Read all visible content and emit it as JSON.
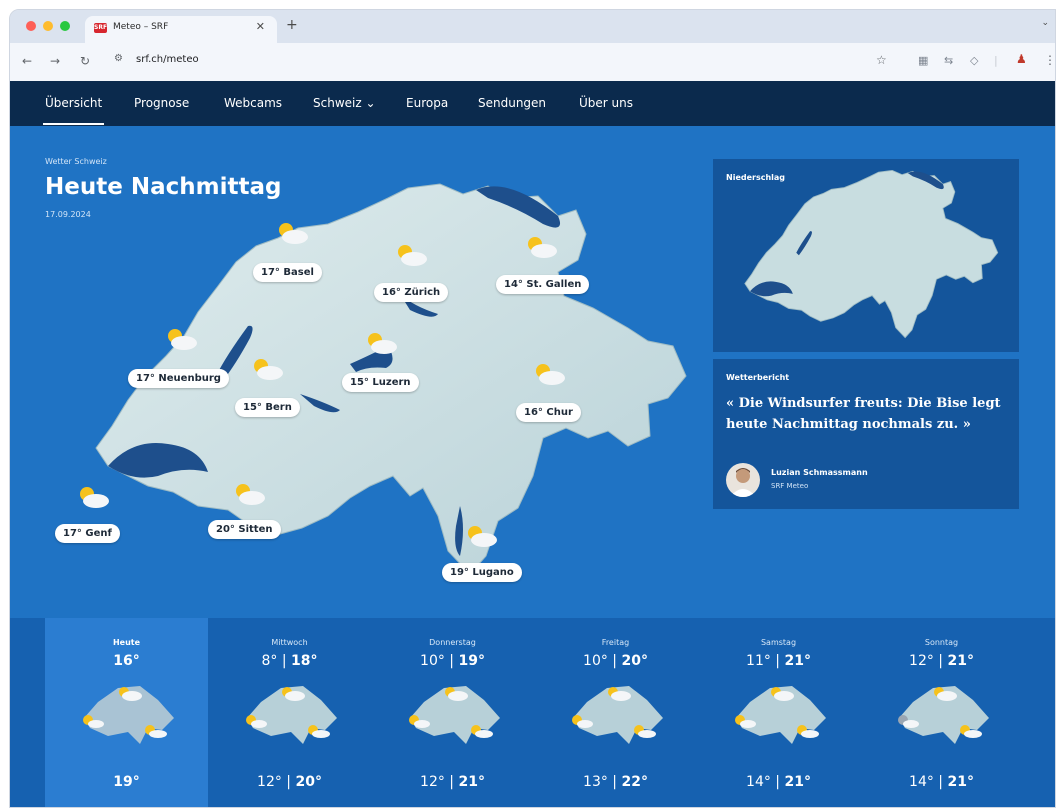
{
  "browser": {
    "tab_title": "Meteo – SRF",
    "tab_favicon": "SRF",
    "url": "srf.ch/meteo"
  },
  "nav": {
    "items": [
      "Übersicht",
      "Prognose",
      "Webcams",
      "Schweiz ⌄",
      "Europa",
      "Sendungen",
      "Über uns"
    ]
  },
  "main": {
    "kicker": "Wetter Schweiz",
    "title": "Heute Nachmittag",
    "date": "17.09.2024"
  },
  "cities": [
    {
      "label": "17°  Basel",
      "icon": "partly-cloudy-icon"
    },
    {
      "label": "16°  Zürich",
      "icon": "partly-cloudy-icon"
    },
    {
      "label": "14°  St. Gallen",
      "icon": "partly-cloudy-icon"
    },
    {
      "label": "17°  Neuenburg",
      "icon": "partly-cloudy-icon"
    },
    {
      "label": "15°  Luzern",
      "icon": "partly-cloudy-icon"
    },
    {
      "label": "15°  Bern",
      "icon": "partly-cloudy-icon"
    },
    {
      "label": "16°  Chur",
      "icon": "partly-cloudy-icon"
    },
    {
      "label": "17°  Genf",
      "icon": "partly-cloudy-icon"
    },
    {
      "label": "20°  Sitten",
      "icon": "partly-cloudy-icon"
    },
    {
      "label": "19°  Lugano",
      "icon": "partly-cloudy-icon"
    }
  ],
  "precip_panel": {
    "label": "Niederschlag"
  },
  "report": {
    "label": "Wetterbericht",
    "quote": "« Die Windsurfer freuts: Die Bise legt heute Nachmittag nochmals zu. »",
    "author": "Luzian Schmassmann",
    "author_sub": "SRF Meteo"
  },
  "forecast": [
    {
      "name": "Heute",
      "top": "16°",
      "top_min": "",
      "top_max": "",
      "bottom": "19°",
      "bottom_min": "",
      "bottom_max": ""
    },
    {
      "name": "Mittwoch",
      "top_min": "8°",
      "top_max": "18°",
      "bottom_min": "12°",
      "bottom_max": "20°"
    },
    {
      "name": "Donnerstag",
      "top_min": "10°",
      "top_max": "19°",
      "bottom_min": "12°",
      "bottom_max": "21°"
    },
    {
      "name": "Freitag",
      "top_min": "10°",
      "top_max": "20°",
      "bottom_min": "13°",
      "bottom_max": "22°"
    },
    {
      "name": "Samstag",
      "top_min": "11°",
      "top_max": "21°",
      "bottom_min": "14°",
      "bottom_max": "21°"
    },
    {
      "name": "Sonntag",
      "top_min": "12°",
      "top_max": "21°",
      "bottom_min": "14°",
      "bottom_max": "21°"
    }
  ],
  "colors": {
    "nav_bg": "#0b2a4d",
    "main_bg": "#1f73c4",
    "panel_bg": "#14559b",
    "forecast_bg": "#1661b0",
    "forecast_active": "#2b7dd1",
    "map_land": "#cfe0e4",
    "lake": "#1e4f8c"
  }
}
